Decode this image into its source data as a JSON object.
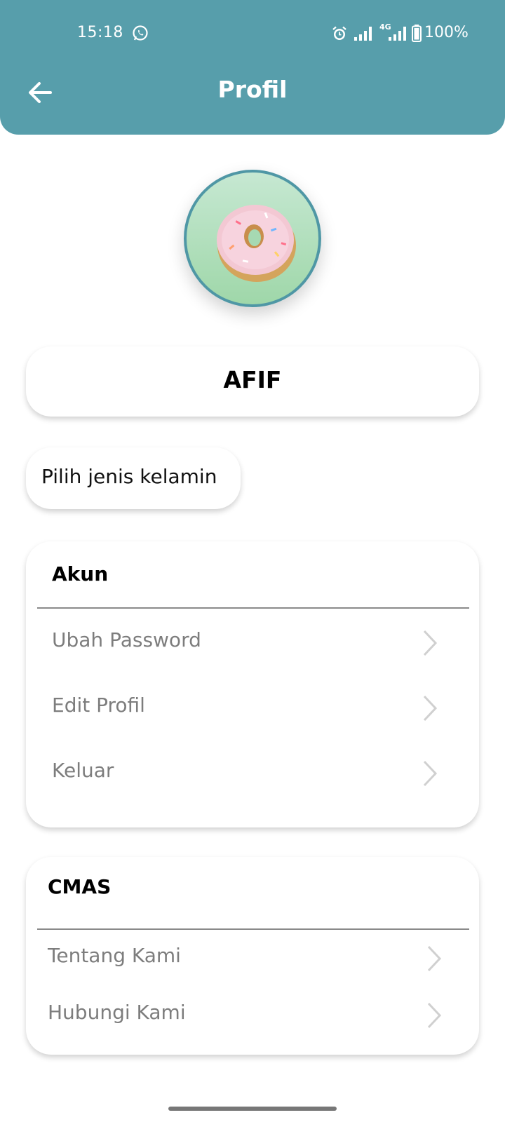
{
  "status_bar": {
    "time": "15:18",
    "network_label": "4G",
    "battery": "100%"
  },
  "header": {
    "title": "Profil"
  },
  "profile": {
    "name": "AFIF",
    "gender_placeholder": "Pilih jenis kelamin"
  },
  "sections": {
    "akun": {
      "title": "Akun",
      "items": [
        {
          "label": "Ubah Password"
        },
        {
          "label": "Edit Profil"
        },
        {
          "label": "Keluar"
        }
      ]
    },
    "cmas": {
      "title": "CMAS",
      "items": [
        {
          "label": "Tentang Kami"
        },
        {
          "label": "Hubungi Kami"
        }
      ]
    }
  },
  "colors": {
    "app_bar": "#579eab",
    "avatar_border": "#4f97a5",
    "row_text": "#7d7d7d"
  }
}
